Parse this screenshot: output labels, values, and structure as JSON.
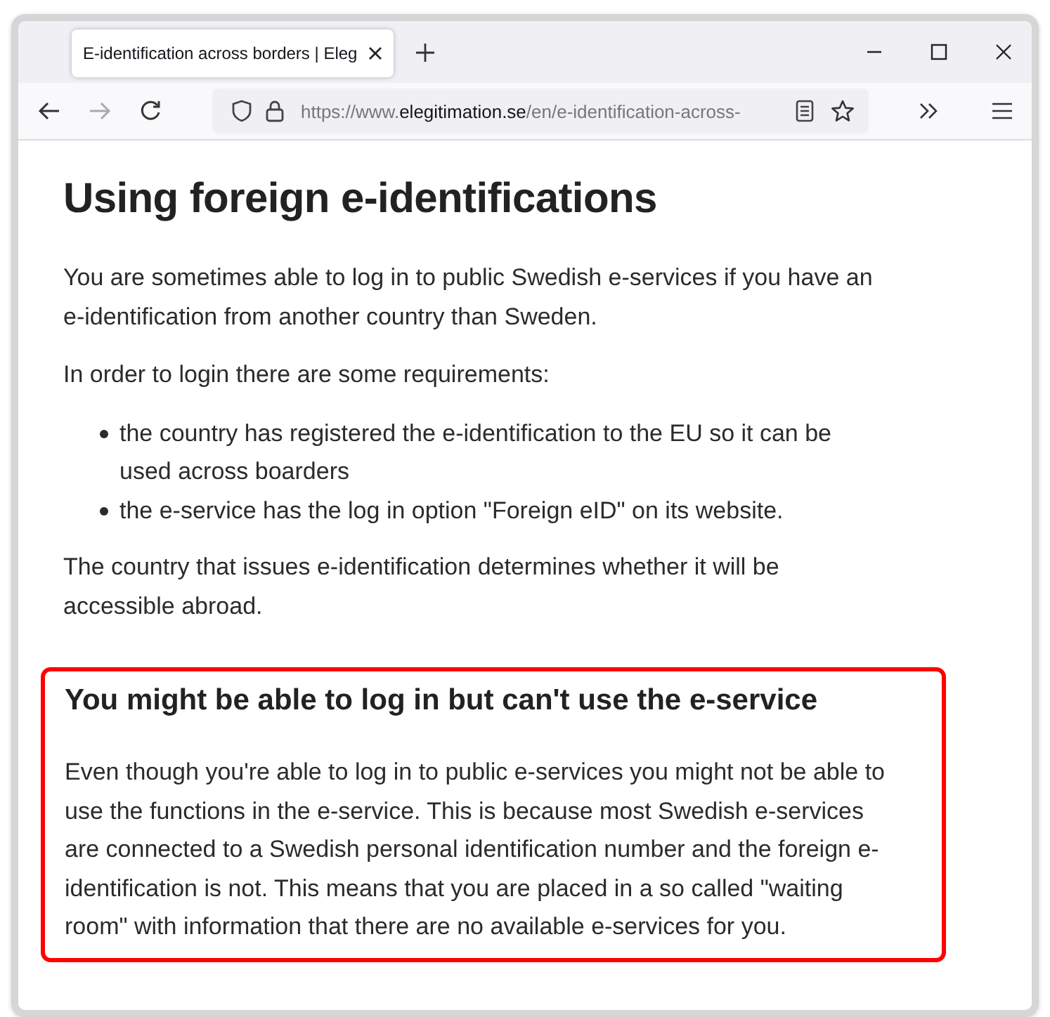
{
  "tab": {
    "title": "E-identification across borders | Eleg",
    "selected": true
  },
  "url": {
    "prefix": "https://www.",
    "domain": "elegitimation.se",
    "path": "/en/e-identification-across-"
  },
  "page": {
    "heading": "Using foreign e-identifications",
    "intro": [
      "You are sometimes able to log in to public Swedish e-services if you have an e-identification from another country than Sweden.",
      "In order to login there are some requirements:"
    ],
    "requirements": [
      "the country has registered the e-identification to the EU so it can be used across boarders",
      "the e-service has the log in option \"Foreign eID\" on its website."
    ],
    "outro": "The country that issues e-identification determines whether it will be accessible abroad.",
    "callout": {
      "heading": "You might be able to log in but can't use the e-service",
      "text": "Even though you're able to log in to public e-services you might not be able to use the functions in the e-service. This is because most Swedish e-services are connected to a Swedish personal identification number and the foreign e-identification is not. This means that you are placed in a so called \"waiting room\" with information that there are no available e-services for you.",
      "highlighted": true
    }
  }
}
